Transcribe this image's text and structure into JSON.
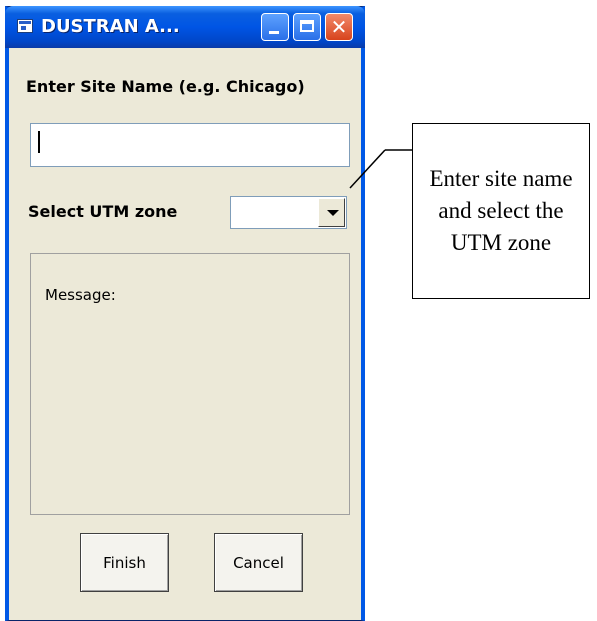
{
  "window": {
    "title": "DUSTRAN A...",
    "title_icon": "app-window-icon"
  },
  "titlebar_buttons": {
    "minimize": "minimize-icon",
    "maximize": "maximize-icon",
    "close_glyph": "✕"
  },
  "form": {
    "site_name_label": "Enter Site Name (e.g. Chicago)",
    "site_name_value": "",
    "utm_label": "Select UTM zone",
    "utm_selected": ""
  },
  "message": {
    "label": "Message:"
  },
  "buttons": {
    "finish": "Finish",
    "cancel": "Cancel"
  },
  "annotation": {
    "callout_text": "Enter site name and select the UTM zone"
  }
}
